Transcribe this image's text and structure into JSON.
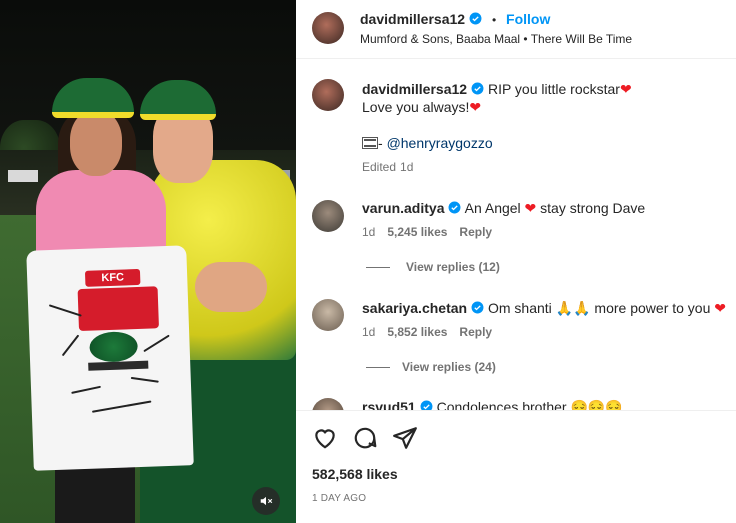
{
  "post": {
    "username": "davidmillersa12",
    "follow_label": "Follow",
    "separator": "•",
    "audio": "Mumford & Sons, Baaba Maal • There Will Be Time"
  },
  "caption": {
    "username": "davidmillersa12",
    "line1": "RIP you little rockstar",
    "line2": "Love you always!",
    "credit_prefix": "- ",
    "credit_handle": "@henryraygozzo",
    "edited": "Edited",
    "age": "1d"
  },
  "comments": [
    {
      "username": "varun.aditya",
      "text": "An Angel ",
      "text2": " stay strong Dave",
      "age": "1d",
      "likes": "5,245 likes",
      "reply_label": "Reply",
      "replies": "View replies (12)"
    },
    {
      "username": "sakariya.chetan",
      "text": "Om shanti ",
      "text2": " more power to you ",
      "age": "1d",
      "likes": "5,852 likes",
      "reply_label": "Reply",
      "replies": "View replies (24)"
    },
    {
      "username": "rsvud51",
      "text": "Condolences brother "
    }
  ],
  "jersey": {
    "logo": "KFC"
  },
  "footer": {
    "likes": "582,568 likes",
    "date": "1 DAY AGO"
  },
  "colors": {
    "verified": "#0095f6",
    "heart": "#ed1c24",
    "link": "#00376b"
  },
  "icons": [
    "heart-icon",
    "comment-icon",
    "share-icon",
    "mute-icon",
    "verified-icon",
    "film-icon",
    "praying-hands-icon",
    "sad-face-icon"
  ]
}
